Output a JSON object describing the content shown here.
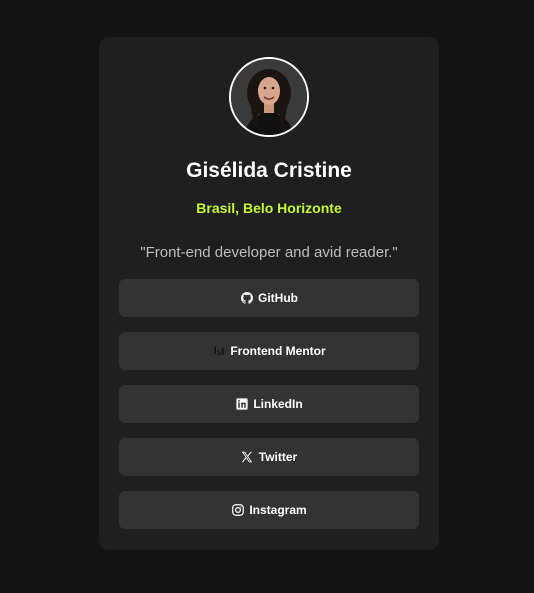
{
  "profile": {
    "name": "Gisélida Cristine",
    "location": "Brasil, Belo Horizonte",
    "bio": "\"Front-end developer and avid reader.\""
  },
  "links": [
    {
      "label": "GitHub",
      "icon": "github-icon"
    },
    {
      "label": "Frontend Mentor",
      "icon": "frontend-mentor-icon"
    },
    {
      "label": "LinkedIn",
      "icon": "linkedin-icon"
    },
    {
      "label": "Twitter",
      "icon": "x-twitter-icon"
    },
    {
      "label": "Instagram",
      "icon": "instagram-icon"
    }
  ],
  "colors": {
    "background": "#141414",
    "card": "#1f1f1f",
    "button": "#333333",
    "accent": "#c4f82a",
    "text": "#ffffff",
    "muted": "#bdbdbd"
  }
}
